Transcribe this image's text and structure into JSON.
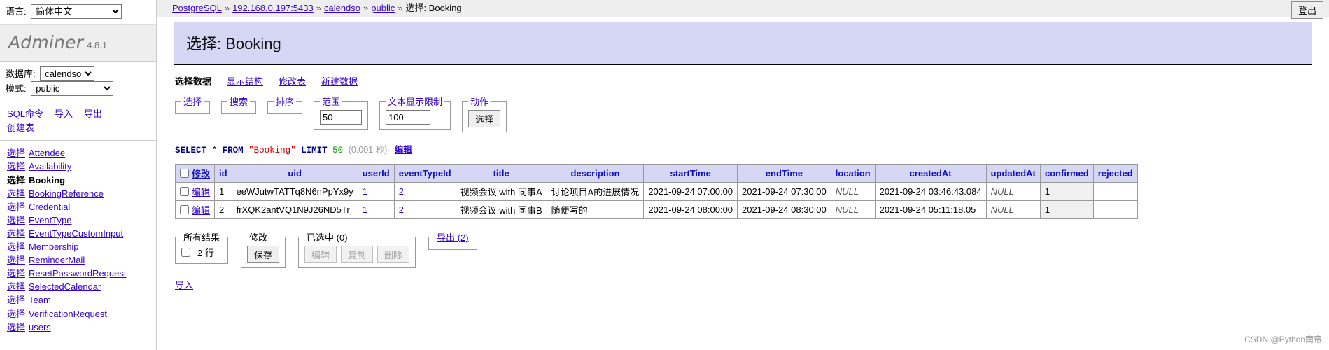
{
  "sidebar": {
    "language_label": "语言:",
    "language_value": "简体中文",
    "language_options": [
      "简体中文"
    ],
    "brand_name": "Adminer",
    "brand_version": "4.8.1",
    "database_label": "数据库:",
    "database_value": "calendso",
    "database_options": [
      "calendso"
    ],
    "schema_label": "模式:",
    "schema_value": "public",
    "schema_options": [
      "public"
    ],
    "actions": [
      {
        "label": "SQL命令"
      },
      {
        "label": "导入"
      },
      {
        "label": "导出"
      },
      {
        "label": "创建表"
      }
    ],
    "select_prefix": "选择",
    "tables": [
      {
        "name": "Attendee",
        "active": false
      },
      {
        "name": "Availability",
        "active": false
      },
      {
        "name": "Booking",
        "active": true
      },
      {
        "name": "BookingReference",
        "active": false
      },
      {
        "name": "Credential",
        "active": false
      },
      {
        "name": "EventType",
        "active": false
      },
      {
        "name": "EventTypeCustomInput",
        "active": false
      },
      {
        "name": "Membership",
        "active": false
      },
      {
        "name": "ReminderMail",
        "active": false
      },
      {
        "name": "ResetPasswordRequest",
        "active": false
      },
      {
        "name": "SelectedCalendar",
        "active": false
      },
      {
        "name": "Team",
        "active": false
      },
      {
        "name": "VerificationRequest",
        "active": false
      },
      {
        "name": "users",
        "active": false
      }
    ]
  },
  "breadcrumb": {
    "items": [
      "PostgreSQL",
      "192.168.0.197:5433",
      "calendso",
      "public"
    ],
    "current": "选择: Booking",
    "separator": "»"
  },
  "header": {
    "logout_label": "登出"
  },
  "page": {
    "title": "选择: Booking"
  },
  "nav_tabs": [
    {
      "label": "选择数据",
      "active": true
    },
    {
      "label": "显示结构",
      "active": false
    },
    {
      "label": "修改表",
      "active": false
    },
    {
      "label": "新建数据",
      "active": false
    }
  ],
  "controls": {
    "select_legend": "选择",
    "search_legend": "搜索",
    "sort_legend": "排序",
    "limit_legend": "范围",
    "limit_value": "50",
    "textlimit_legend": "文本显示限制",
    "textlimit_value": "100",
    "action_legend": "动作",
    "action_button": "选择"
  },
  "sql": {
    "keyword1": "SELECT",
    "star": "*",
    "keyword2": "FROM",
    "table": "\"Booking\"",
    "keyword3": "LIMIT",
    "limit": "50",
    "timing": "(0.001 秒)",
    "edit_label": "编辑"
  },
  "table": {
    "edit_header": "修改",
    "edit_label": "编辑",
    "columns": [
      "id",
      "uid",
      "userId",
      "eventTypeId",
      "title",
      "description",
      "startTime",
      "endTime",
      "location",
      "createdAt",
      "updatedAt",
      "confirmed",
      "rejected"
    ],
    "rows": [
      {
        "id": "1",
        "uid": "eeWJutwTATTq8N6nPpYx9y",
        "userId": "1",
        "eventTypeId": "2",
        "title": "视频会议 with 同事A",
        "description": "讨论项目A的进展情况",
        "startTime": "2021-09-24 07:00:00",
        "endTime": "2021-09-24 07:30:00",
        "location": "NULL",
        "createdAt": "2021-09-24 03:46:43.084",
        "updatedAt": "NULL",
        "confirmed": "1",
        "rejected": ""
      },
      {
        "id": "2",
        "uid": "frXQK2antVQ1N9J26ND5Tr",
        "userId": "1",
        "eventTypeId": "2",
        "title": "视频会议 with 同事B",
        "description": "随便写的",
        "startTime": "2021-09-24 08:00:00",
        "endTime": "2021-09-24 08:30:00",
        "location": "NULL",
        "createdAt": "2021-09-24 05:11:18.05",
        "updatedAt": "NULL",
        "confirmed": "1",
        "rejected": ""
      }
    ]
  },
  "bottom": {
    "all_results_legend": "所有结果",
    "all_results_count": "2 行",
    "modify_legend": "修改",
    "save_label": "保存",
    "selected_legend": "已选中 (0)",
    "edit_label": "编辑",
    "clone_label": "复制",
    "delete_label": "删除",
    "export_legend": "导出 (2)",
    "import_label": "导入"
  },
  "watermark": "CSDN @Python南帝",
  "colors": {
    "accent": "#d6d6f5",
    "link": "#3300cc",
    "header_text": "#1111bb"
  }
}
